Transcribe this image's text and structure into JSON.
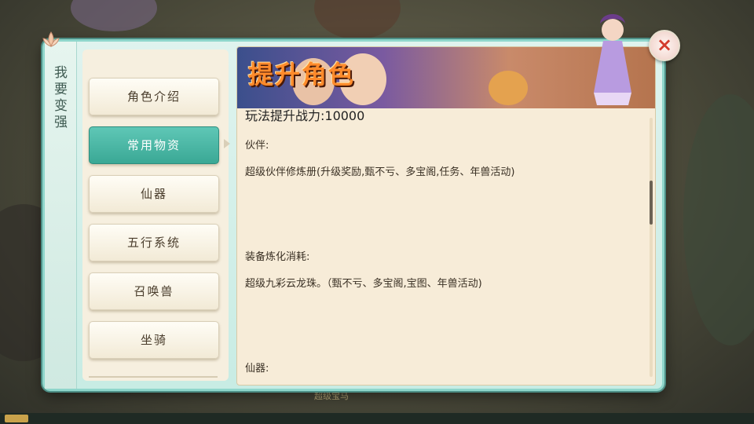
{
  "sidebar": {
    "title": "我要变强"
  },
  "menu": {
    "items": [
      {
        "label": "角色介绍",
        "active": false
      },
      {
        "label": "常用物资",
        "active": true
      },
      {
        "label": "仙器",
        "active": false
      },
      {
        "label": "五行系统",
        "active": false
      },
      {
        "label": "召唤兽",
        "active": false
      },
      {
        "label": "坐骑",
        "active": false
      }
    ]
  },
  "banner": {
    "title": "提升角色"
  },
  "content": {
    "power_line": "玩法提升战力:10000",
    "sections": [
      {
        "heading": "伙伴:",
        "body": "超级伙伴修炼册(升级奖励,甄不亏、多宝阁,任务、年兽活动)"
      },
      {
        "heading": "装备炼化消耗:",
        "body": "超级九彩云龙珠。（甄不亏、多宝阁,宝图、年兽活动)"
      },
      {
        "heading": "仙器:",
        "body": ""
      }
    ]
  },
  "bottom": {
    "hint": "超级宝马"
  },
  "colors": {
    "accent": "#3aa895",
    "panel": "#f7ecd8",
    "frame": "#8fd6cb",
    "close": "#d33a2c"
  },
  "icons": {
    "close": "close-icon",
    "lotus": "lotus-icon"
  }
}
